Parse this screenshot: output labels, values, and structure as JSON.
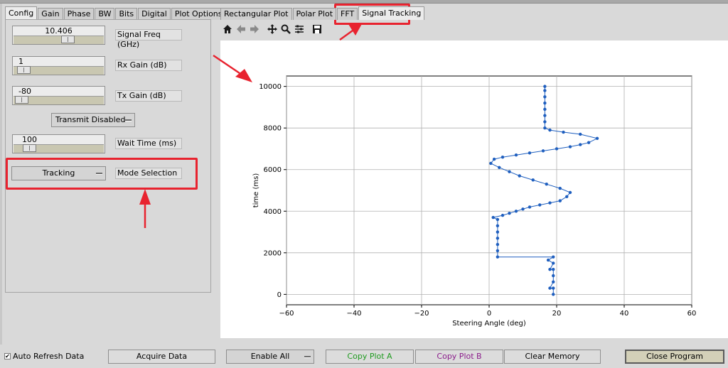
{
  "left_tabs": [
    "Config",
    "Gain",
    "Phase",
    "BW",
    "Bits",
    "Digital",
    "Plot Options"
  ],
  "right_tabs": [
    "Rectangular Plot",
    "Polar Plot",
    "FFT",
    "Signal Tracking"
  ],
  "signal_freq": {
    "value": "10.406",
    "label": "Signal Freq (GHz)",
    "fraction": 0.6
  },
  "rx_gain": {
    "value": "1",
    "label": "Rx Gain (dB)",
    "fraction": 0.03
  },
  "tx_gain": {
    "value": "-80",
    "label": "Tx Gain (dB)",
    "fraction": 0.0
  },
  "transmit": {
    "value": "Transmit Disabled"
  },
  "wait_time": {
    "value": "100",
    "label": "Wait Time (ms)",
    "fraction": 0.1
  },
  "mode": {
    "value": "Tracking",
    "label": "Mode Selection"
  },
  "bottom": {
    "auto_refresh_label": "Auto Refresh Data",
    "auto_refresh_checked": "✔",
    "acquire": "Acquire Data",
    "enable_all": "Enable All",
    "copy_a": "Copy Plot A",
    "copy_b": "Copy Plot B",
    "clear": "Clear Memory",
    "close": "Close Program"
  },
  "colors": {
    "copy_a": "#1f9a1f",
    "copy_b": "#8b1d8b",
    "accent": "#e8232f",
    "series": "#1f5fbf"
  },
  "chart_data": {
    "type": "scatter",
    "xlabel": "Steering Angle (deg)",
    "ylabel": "time (ms)",
    "xlim": [
      -60,
      60
    ],
    "ylim": [
      -500,
      10500
    ],
    "xticks": [
      -60,
      -40,
      -20,
      0,
      20,
      40,
      60
    ],
    "yticks": [
      0,
      2000,
      4000,
      6000,
      8000,
      10000
    ],
    "grid": true,
    "series": [
      {
        "values": [
          [
            19,
            0
          ],
          [
            19,
            300
          ],
          [
            18,
            300
          ],
          [
            19,
            600
          ],
          [
            19,
            900
          ],
          [
            19,
            1200
          ],
          [
            18,
            1200
          ],
          [
            19,
            1500
          ],
          [
            17.5,
            1650
          ],
          [
            19,
            1800
          ],
          [
            2.5,
            1800
          ],
          [
            2.5,
            2100
          ],
          [
            2.5,
            2400
          ],
          [
            2.5,
            2700
          ],
          [
            2.5,
            3000
          ],
          [
            2.5,
            3300
          ],
          [
            2.5,
            3600
          ],
          [
            1.2,
            3700
          ],
          [
            4,
            3800
          ],
          [
            6,
            3900
          ],
          [
            8,
            4000
          ],
          [
            10,
            4100
          ],
          [
            12,
            4200
          ],
          [
            15,
            4300
          ],
          [
            18,
            4400
          ],
          [
            21,
            4500
          ],
          [
            23,
            4700
          ],
          [
            24,
            4900
          ],
          [
            21,
            5100
          ],
          [
            17,
            5300
          ],
          [
            13,
            5500
          ],
          [
            9,
            5700
          ],
          [
            6,
            5900
          ],
          [
            3,
            6100
          ],
          [
            0.5,
            6300
          ],
          [
            1.5,
            6500
          ],
          [
            4,
            6600
          ],
          [
            8,
            6700
          ],
          [
            12,
            6800
          ],
          [
            16,
            6900
          ],
          [
            20,
            7000
          ],
          [
            24,
            7100
          ],
          [
            27,
            7200
          ],
          [
            29.5,
            7300
          ],
          [
            32,
            7500
          ],
          [
            27,
            7700
          ],
          [
            22,
            7800
          ],
          [
            18,
            7900
          ],
          [
            16.5,
            8000
          ],
          [
            16.5,
            8300
          ],
          [
            16.5,
            8600
          ],
          [
            16.5,
            8900
          ],
          [
            16.5,
            9200
          ],
          [
            16.5,
            9500
          ],
          [
            16.5,
            9800
          ],
          [
            16.5,
            10000
          ]
        ]
      }
    ]
  }
}
